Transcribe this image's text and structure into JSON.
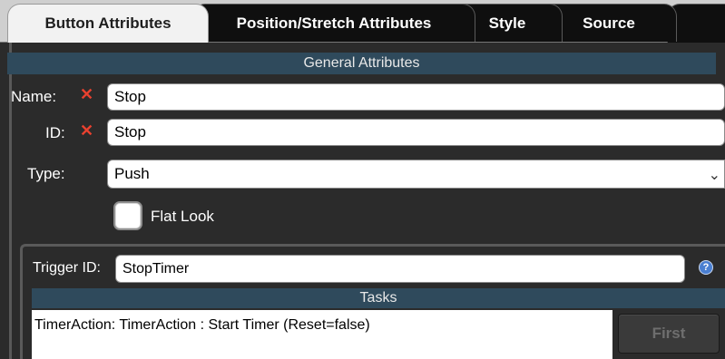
{
  "tabs": [
    {
      "label": "Button Attributes",
      "active": true
    },
    {
      "label": "Position/Stretch Attributes",
      "active": false
    },
    {
      "label": "Style",
      "active": false
    },
    {
      "label": "Source",
      "active": false
    }
  ],
  "general": {
    "header": "General Attributes",
    "name_label": "Name:",
    "name_value": "Stop",
    "id_label": "ID:",
    "id_value": "Stop",
    "type_label": "Type:",
    "type_value": "Push",
    "flat_look_label": "Flat Look"
  },
  "trigger": {
    "label": "Trigger ID:",
    "value": "StopTimer",
    "tasks_header": "Tasks",
    "tasks": [
      "TimerAction: TimerAction : Start Timer (Reset=false)"
    ],
    "first_button": "First"
  },
  "icons": {
    "invalid": "x-icon",
    "dropdown": "chevron-down-icon",
    "help": "help-icon"
  },
  "colors": {
    "section_header": "#2f4a5c",
    "error_x": "#e8412f",
    "help_icon": "#4a7fd1"
  }
}
